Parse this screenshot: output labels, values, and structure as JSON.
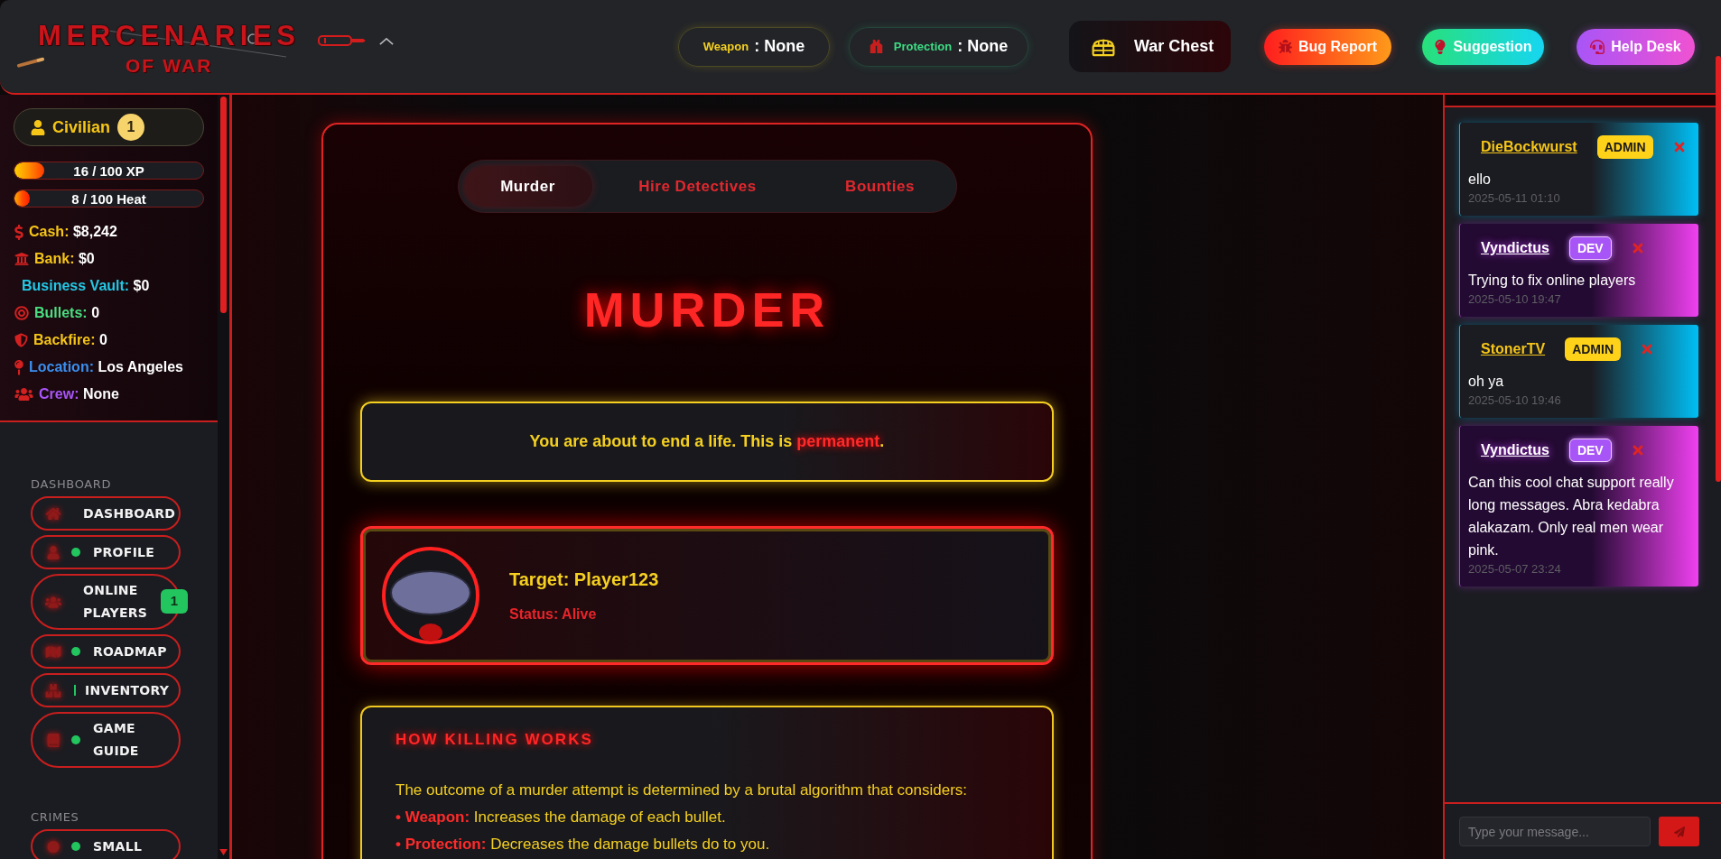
{
  "header": {
    "logo": {
      "title": "MERCENARIES",
      "subtitle": "OF WAR"
    },
    "equipment": [
      {
        "kind": "weapon",
        "label": "Weapon",
        "value": ": None"
      },
      {
        "kind": "protection",
        "label": "Protection",
        "value": ": None"
      }
    ],
    "war_chest": {
      "label": "War Chest"
    },
    "buttons": [
      {
        "kind": "bug",
        "label": "Bug Report"
      },
      {
        "kind": "suggestion",
        "label": "Suggestion"
      },
      {
        "kind": "help",
        "label": "Help Desk"
      }
    ]
  },
  "player": {
    "rank": "Civilian",
    "rank_badge": "1",
    "bars": [
      {
        "kind": "xp",
        "text": "16 / 100 XP",
        "level": 0.16
      },
      {
        "kind": "heat",
        "text": "8 / 100 Heat",
        "level": 0.08
      }
    ],
    "stats": [
      {
        "kind": "cash",
        "label": "Cash:",
        "value": "$8,242"
      },
      {
        "kind": "bank",
        "label": "Bank:",
        "value": "$0"
      },
      {
        "kind": "vault",
        "label": "Business Vault:",
        "value": "$0"
      },
      {
        "kind": "bullets",
        "label": "Bullets:",
        "value": "0"
      },
      {
        "kind": "backfire",
        "label": "Backfire:",
        "value": "0"
      },
      {
        "kind": "location",
        "label": "Location:",
        "value": "Los Angeles"
      },
      {
        "kind": "crew",
        "label": "Crew:",
        "value": "None"
      }
    ]
  },
  "sidebar": {
    "sections": [
      {
        "title": "DASHBOARD",
        "items": [
          {
            "kind": "home",
            "label": "DASHBOARD"
          },
          {
            "kind": "profile",
            "label": "PROFILE",
            "indicator": {
              "kind": "dot"
            }
          },
          {
            "kind": "players",
            "label": "ONLINE PLAYERS",
            "badge": "1"
          },
          {
            "kind": "map",
            "label": "ROADMAP",
            "indicator": {
              "kind": "dot"
            }
          },
          {
            "kind": "inventory",
            "label": "INVENTORY",
            "indicator": {
              "kind": "bar"
            }
          },
          {
            "kind": "guide",
            "label": "GAME GUIDE",
            "indicator": {
              "kind": "dot"
            }
          }
        ]
      },
      {
        "title": "CRIMES",
        "items": [
          {
            "kind": "crime",
            "label": "SMALL",
            "indicator": {
              "kind": "dot"
            }
          }
        ]
      }
    ]
  },
  "main": {
    "tabs": [
      {
        "label": "Murder",
        "selected": true
      },
      {
        "label": "Hire Detectives",
        "selected": false
      },
      {
        "label": "Bounties",
        "selected": false
      }
    ],
    "title": "MURDER",
    "warning": "You are about to end a life. This is **permanent**.",
    "target": {
      "name": "Target: Player123",
      "status": "Status: Alive"
    },
    "info": {
      "title": "HOW KILLING WORKS",
      "intro": "The outcome of a murder attempt is determined by a brutal algorithm that considers:",
      "points": [
        "**• Weapon:** Increases the damage of each bullet.",
        "**• Protection:** Decreases the damage bullets do to you."
      ]
    }
  },
  "chat": {
    "messages": [
      {
        "kind": "admin",
        "user": "DieBockwurst",
        "badge": "ADMIN",
        "text": "ello",
        "time": "2025-05-11 01:10"
      },
      {
        "kind": "dev",
        "user": "Vyndictus",
        "badge": "DEV",
        "text": "Trying to fix online players",
        "time": "2025-05-10 19:47"
      },
      {
        "kind": "admin",
        "user": "StonerTV",
        "badge": "ADMIN",
        "text": "oh ya",
        "time": "2025-05-10 19:46"
      },
      {
        "kind": "dev",
        "user": "Vyndictus",
        "badge": "DEV",
        "text": "Can this cool chat support really long messages. Abra kedabra alakazam. Only real men wear pink.",
        "time": "2025-05-07 23:24"
      }
    ],
    "input": {
      "placeholder": "Type your message..."
    }
  }
}
